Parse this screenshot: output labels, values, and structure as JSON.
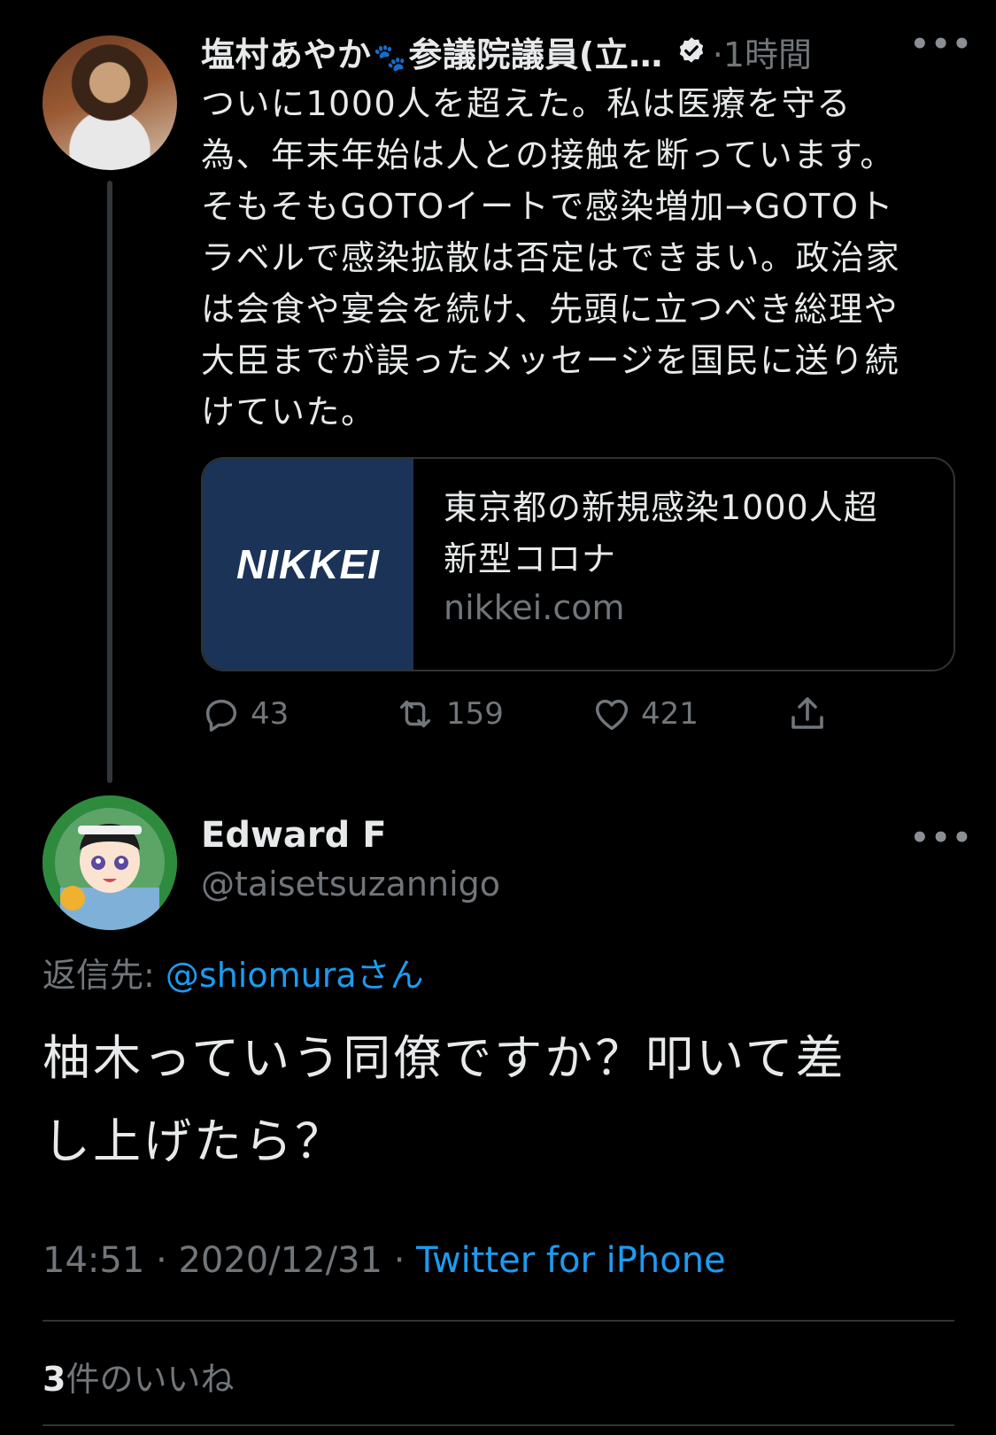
{
  "parent_tweet": {
    "author_name": "塩村あやか",
    "author_title": "参議院議員(立…",
    "name_emoji": "paw-prints-icon",
    "verified": true,
    "time_ago": "1時間",
    "text": "ついに1000人を超えた。私は医療を守る\n為、年末年始は人との接触を断っています。\nそもそもGOTOイートで感染増加→GOTOト\nラベルで感染拡散は否定はできまい。政治家\nは会食や宴会を続け、先頭に立つべき総理や\n大臣までが誤ったメッセージを国民に送り続\nけていた。",
    "card": {
      "thumbnail_text": "NIKKEI",
      "title": "東京都の新規感染1000人超\n新型コロナ",
      "domain": "nikkei.com"
    },
    "actions": {
      "replies": "43",
      "retweets": "159",
      "likes": "421"
    }
  },
  "reply_tweet": {
    "author_name": "Edward F",
    "author_handle": "@taisetsuzannigo",
    "replying_to_label": "返信先:",
    "replying_to_mention": "@shiomura",
    "replying_to_suffix": "さん",
    "text": "柚木っていう同僚ですか？叩いて差\nし上げたら？",
    "time": "14:51",
    "date": "2020/12/31",
    "source": "Twitter for iPhone",
    "likes_count": "3",
    "likes_label": "件のいいね"
  },
  "colors": {
    "background": "#000000",
    "text_primary": "#e7e9ea",
    "text_secondary": "#71767b",
    "link": "#1d9bf0",
    "card_thumb_bg": "#1b3357",
    "border": "#2f3336"
  }
}
